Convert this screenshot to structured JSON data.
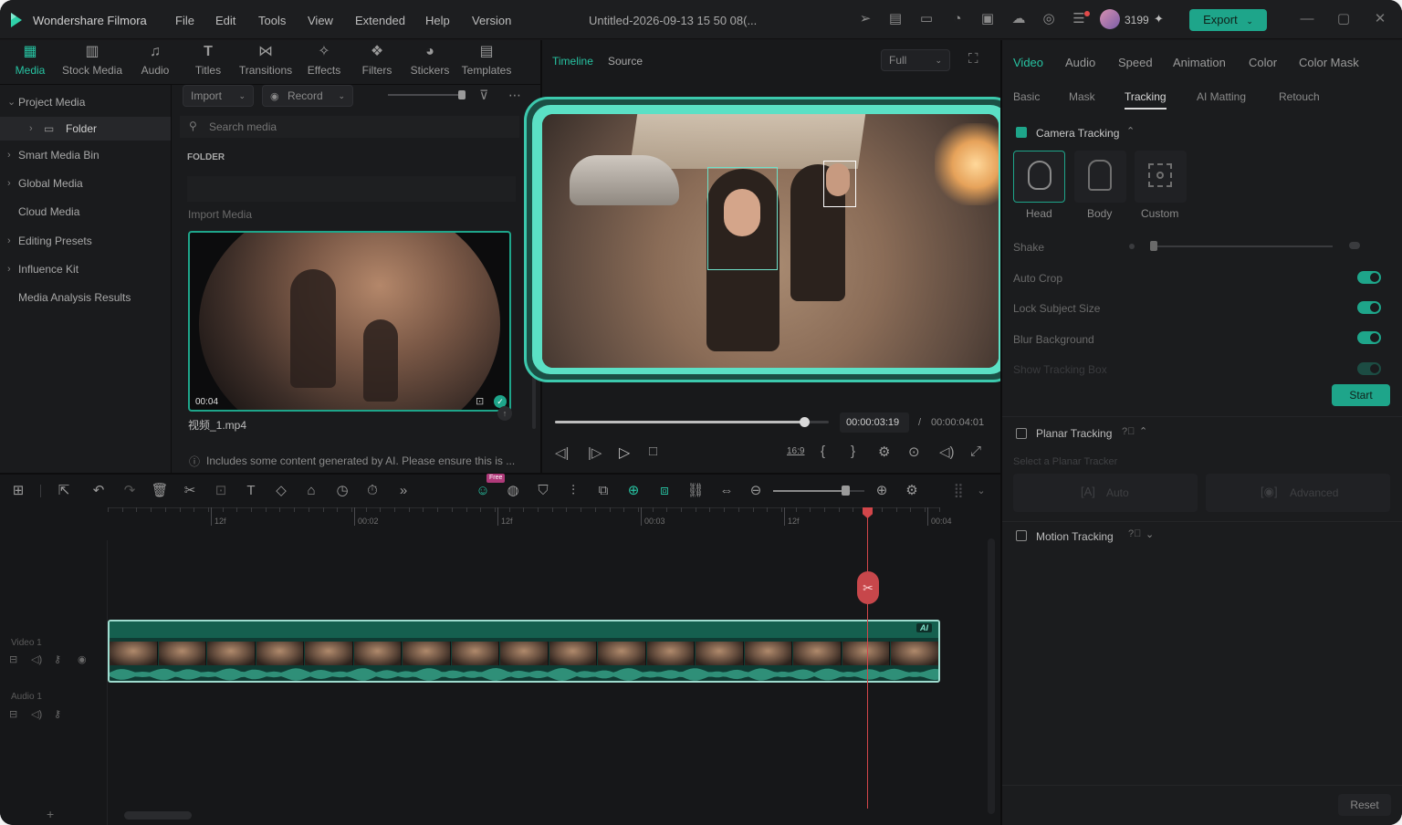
{
  "app": {
    "title": "Wondershare Filmora",
    "project": "Untitled-2026-09-13 15 50 08(...",
    "credits": "3199",
    "export_label": "Export"
  },
  "menu": [
    "File",
    "Edit",
    "Tools",
    "View",
    "Extended",
    "Help",
    "Version"
  ],
  "nav_tabs": [
    {
      "label": "Media",
      "icon": "media-icon",
      "active": true
    },
    {
      "label": "Stock Media",
      "icon": "stock-media-icon"
    },
    {
      "label": "Audio",
      "icon": "music-note-icon"
    },
    {
      "label": "Titles",
      "icon": "text-icon"
    },
    {
      "label": "Transitions",
      "icon": "transition-icon"
    },
    {
      "label": "Effects",
      "icon": "effects-icon"
    },
    {
      "label": "Filters",
      "icon": "filters-icon"
    },
    {
      "label": "Stickers",
      "icon": "stickers-icon"
    },
    {
      "label": "Templates",
      "icon": "templates-icon"
    }
  ],
  "sidebar": {
    "items": [
      {
        "label": "Project Media",
        "expanded": true
      },
      {
        "label": "Folder",
        "selected": true
      },
      {
        "label": "Smart Media Bin"
      },
      {
        "label": "Global Media"
      },
      {
        "label": "Cloud Media"
      },
      {
        "label": "Editing Presets"
      },
      {
        "label": "Influence Kit"
      },
      {
        "label": "Media Analysis Results"
      }
    ]
  },
  "media": {
    "import_label": "Import",
    "record_label": "Record",
    "search_placeholder": "Search media",
    "folder_heading": "FOLDER",
    "import_media_label": "Import Media",
    "clip_duration": "00:04",
    "clip_name": "视频_1.mp4",
    "ai_notice": "Includes some content generated by AI. Please ensure this is ..."
  },
  "player": {
    "tab_timeline": "Timeline",
    "tab_source": "Source",
    "quality": "Full",
    "current_time": "00:00:03:19",
    "separator": "/",
    "total_time": "00:00:04:01",
    "aspect": "16:9",
    "progress": 0.91
  },
  "right_panel": {
    "tabs": [
      "Video",
      "Audio",
      "Speed",
      "Animation",
      "Color",
      "Color Mask"
    ],
    "active_tab": "Video",
    "subtabs": [
      "Basic",
      "Mask",
      "Tracking",
      "AI Matting",
      "Retouch"
    ],
    "active_subtab": "Tracking",
    "camera_tracking": "Camera Tracking",
    "track_modes": [
      "Head",
      "Body",
      "Custom"
    ],
    "shake_label": "Shake",
    "auto_crop": "Auto Crop",
    "lock_subject_size": "Lock Subject Size",
    "blur_background": "Blur Background",
    "show_tracking_box": "Show Tracking Box",
    "start_label": "Start",
    "planar_tracking": "Planar Tracking",
    "planar_hint": "Select a Planar Tracker",
    "planar_auto": "Auto",
    "planar_advanced": "Advanced",
    "motion_tracking": "Motion Tracking",
    "reset_label": "Reset"
  },
  "timeline": {
    "ruler": [
      "12f",
      "00:02",
      "12f",
      "00:03",
      "12f",
      "00:04"
    ],
    "video_track": "Video 1",
    "audio_track": "Audio 1",
    "ai_badge": "AI",
    "free_badge": "Free"
  },
  "colors": {
    "accent": "#1ea58a",
    "highlight": "#4fe0c3",
    "playhead": "#d2464a"
  }
}
